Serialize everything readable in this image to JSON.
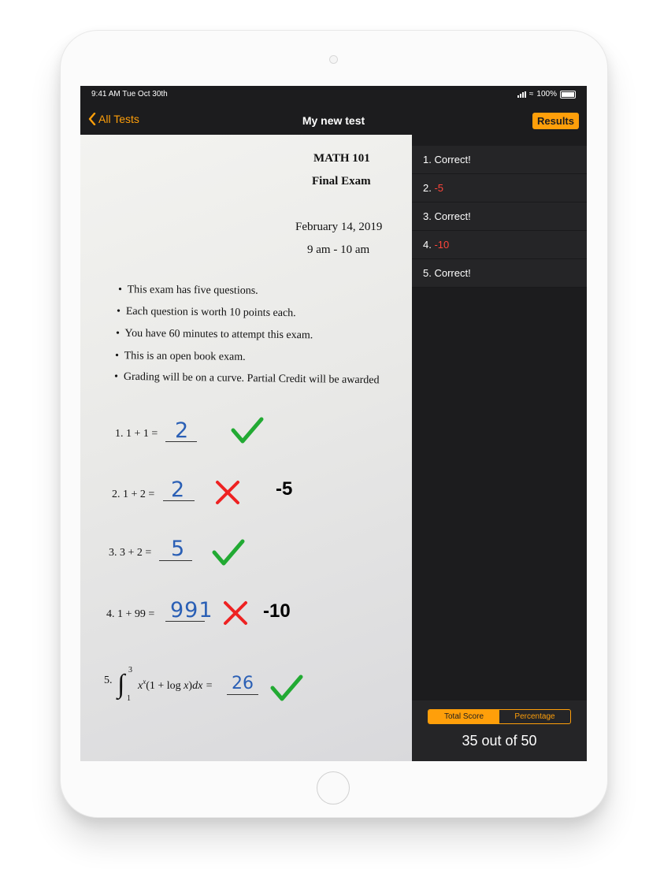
{
  "status_bar": {
    "time": "9:41 AM  Tue Oct 30th",
    "battery": "100%"
  },
  "nav": {
    "back_label": "All Tests",
    "title": "My new test",
    "results_label": "Results"
  },
  "exam": {
    "course": "MATH 101",
    "name": "Final Exam",
    "date": "February 14, 2019",
    "time": "9 am - 10 am",
    "bullets": [
      "This exam has five questions.",
      "Each question is worth 10 points each.",
      "You have 60 minutes to attempt this exam.",
      "This is an open book exam.",
      "Grading will be on a curve. Partial Credit will be awarded"
    ],
    "questions": [
      {
        "prompt": "1.  1 + 1 =",
        "answer": "2",
        "mark": "check"
      },
      {
        "prompt": "2.  1 + 2 =",
        "answer": "2",
        "mark": "cross",
        "deduction": "-5"
      },
      {
        "prompt": "3.  3 + 2 =",
        "answer": "5",
        "mark": "check"
      },
      {
        "prompt": "4.  1 + 99 =",
        "answer": "991",
        "mark": "cross",
        "deduction": "-10"
      },
      {
        "prompt": "5.",
        "answer": "26",
        "mark": "check"
      }
    ]
  },
  "results": {
    "items": [
      {
        "num": "1.",
        "text": "Correct!"
      },
      {
        "num": "2.",
        "text": "-5"
      },
      {
        "num": "3.",
        "text": "Correct!"
      },
      {
        "num": "4.",
        "text": "-10"
      },
      {
        "num": "5.",
        "text": "Correct!"
      }
    ],
    "segments": [
      "Total Score",
      "Percentage"
    ],
    "score": "35 out of 50"
  },
  "colors": {
    "accent": "#ff9f0a",
    "error": "#ff453a",
    "check": "#22aa33",
    "cross": "#ee2222",
    "ink": "#2a5fb5"
  }
}
